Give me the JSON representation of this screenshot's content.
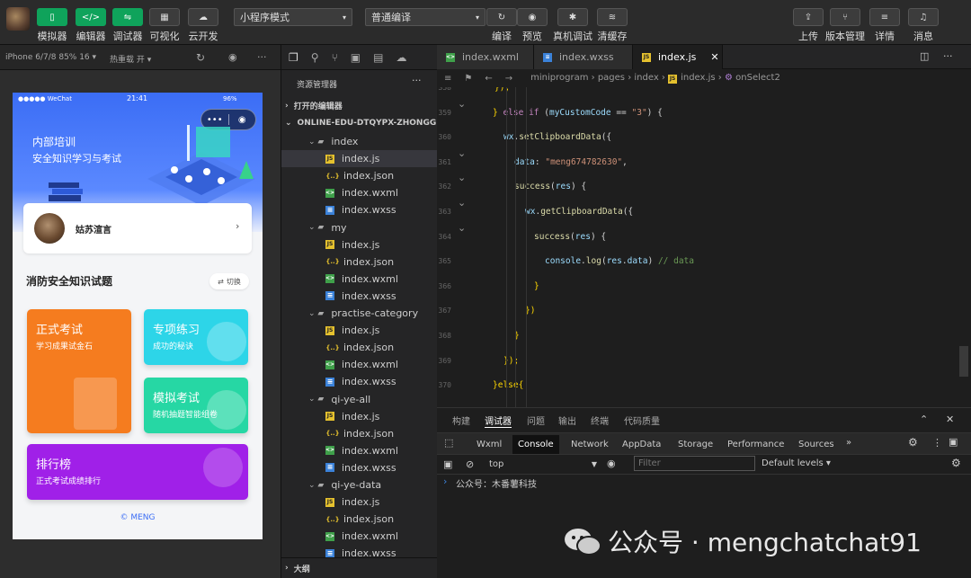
{
  "toolbar": {
    "left_buttons": [
      {
        "label": "模拟器",
        "icon": "phone-icon",
        "glyph": "▯"
      },
      {
        "label": "编辑器",
        "icon": "code-icon",
        "glyph": "</>"
      },
      {
        "label": "调试器",
        "icon": "debug-icon",
        "glyph": "⇋"
      },
      {
        "label": "可视化",
        "icon": "layout-icon",
        "glyph": "▦"
      },
      {
        "label": "云开发",
        "icon": "cloud-icon",
        "glyph": "☁"
      }
    ],
    "mode_select": "小程序模式",
    "compile_select": "普通编译",
    "mid_buttons": [
      {
        "label": "编译",
        "icon": "refresh-icon",
        "glyph": "↻"
      },
      {
        "label": "预览",
        "icon": "eye-icon",
        "glyph": "◉"
      },
      {
        "label": "真机调试",
        "icon": "bug-icon",
        "glyph": "✱"
      },
      {
        "label": "清缓存",
        "icon": "layers-icon",
        "glyph": "≋"
      }
    ],
    "right_buttons": [
      {
        "label": "上传",
        "icon": "upload-icon",
        "glyph": "⇪"
      },
      {
        "label": "版本管理",
        "icon": "branch-icon",
        "glyph": "⑂"
      },
      {
        "label": "详情",
        "icon": "menu-icon",
        "glyph": "≡"
      },
      {
        "label": "消息",
        "icon": "bell-icon",
        "glyph": "♫"
      }
    ]
  },
  "simulator": {
    "device": "iPhone 6/7/8 85% 16 ▾",
    "hot_reload": "热重载 开 ▾",
    "more": "···"
  },
  "phone": {
    "status_carrier": "●●●●● WeChat",
    "status_time": "21:41",
    "status_battery": "96%",
    "capsule_more": "•••",
    "banner_title": "内部培训",
    "banner_subtitle": "安全知识学习与考试",
    "user_name": "姑苏渲言",
    "section_title": "消防安全知识试题",
    "switch_label": "切换",
    "cards": [
      {
        "title": "正式考试",
        "desc": "学习成果试金石",
        "color": "#f57c1f"
      },
      {
        "title": "专项练习",
        "desc": "成功的秘诀",
        "color": "#2dd5e8"
      },
      {
        "title": "模拟考试",
        "desc": "随机抽题智能组卷",
        "color": "#26d7a4"
      },
      {
        "title": "排行榜",
        "desc": "正式考试成绩排行",
        "color": "#a020e8"
      }
    ],
    "footer": "© MENG"
  },
  "explorer": {
    "title": "资源管理器",
    "more": "···",
    "open_editors": "打开的编辑器",
    "project": "ONLINE-EDU-DTQYPX-ZHONGG...",
    "rows": [
      {
        "type": "folder",
        "label": "index",
        "indent": 1
      },
      {
        "type": "js",
        "label": "index.js",
        "indent": 2,
        "selected": true
      },
      {
        "type": "json",
        "label": "index.json",
        "indent": 2
      },
      {
        "type": "wxml",
        "label": "index.wxml",
        "indent": 2
      },
      {
        "type": "wxss",
        "label": "index.wxss",
        "indent": 2
      },
      {
        "type": "folder",
        "label": "my",
        "indent": 1
      },
      {
        "type": "js",
        "label": "index.js",
        "indent": 2
      },
      {
        "type": "json",
        "label": "index.json",
        "indent": 2
      },
      {
        "type": "wxml",
        "label": "index.wxml",
        "indent": 2
      },
      {
        "type": "wxss",
        "label": "index.wxss",
        "indent": 2
      },
      {
        "type": "folder",
        "label": "practise-category",
        "indent": 1
      },
      {
        "type": "js",
        "label": "index.js",
        "indent": 2
      },
      {
        "type": "json",
        "label": "index.json",
        "indent": 2
      },
      {
        "type": "wxml",
        "label": "index.wxml",
        "indent": 2
      },
      {
        "type": "wxss",
        "label": "index.wxss",
        "indent": 2
      },
      {
        "type": "folder",
        "label": "qi-ye-all",
        "indent": 1
      },
      {
        "type": "js",
        "label": "index.js",
        "indent": 2
      },
      {
        "type": "json",
        "label": "index.json",
        "indent": 2
      },
      {
        "type": "wxml",
        "label": "index.wxml",
        "indent": 2
      },
      {
        "type": "wxss",
        "label": "index.wxss",
        "indent": 2
      },
      {
        "type": "folder",
        "label": "qi-ye-data",
        "indent": 1
      },
      {
        "type": "js",
        "label": "index.js",
        "indent": 2
      },
      {
        "type": "json",
        "label": "index.json",
        "indent": 2
      },
      {
        "type": "wxml",
        "label": "index.wxml",
        "indent": 2
      },
      {
        "type": "wxss",
        "label": "index.wxss",
        "indent": 2
      }
    ],
    "outline": "大纲"
  },
  "editor": {
    "tabs": [
      {
        "label": "index.wxml",
        "type": "wxml"
      },
      {
        "label": "index.wxss",
        "type": "wxss"
      },
      {
        "label": "index.js",
        "type": "js",
        "active": true
      }
    ],
    "breadcrumb": [
      "miniprogram",
      "pages",
      "index",
      "index.js",
      "onSelect2"
    ],
    "lines": [
      {
        "n": "358",
        "html": "<span style='margin-left:64px' class='pl'>});</span>"
      },
      {
        "n": "359",
        "html": "<span style='margin-left:62px' class='pl'>}</span> <span class='kw'>else if</span> (<span class='var'>myCustomCode</span> == <span class='str'>\"3\"</span>) {"
      },
      {
        "n": "360",
        "html": "<span style='margin-left:74px'><span class='var'>wx</span>.<span class='fn'>setClipboardData</span>({</span>"
      },
      {
        "n": "361",
        "html": "<span style='margin-left:86px'><span class='var'>data</span>: <span class='str'>\"meng674782630\"</span>,</span>"
      },
      {
        "n": "362",
        "html": "<span style='margin-left:86px'><span class='fn'>success</span>(<span class='var'>res</span>) {</span>"
      },
      {
        "n": "363",
        "html": "<span style='margin-left:98px'><span class='var'>wx</span>.<span class='fn'>getClipboardData</span>({</span>"
      },
      {
        "n": "364",
        "html": "<span style='margin-left:108px'><span class='fn'>success</span>(<span class='var'>res</span>) {</span>"
      },
      {
        "n": "365",
        "html": "<span style='margin-left:120px'><span class='var'>console</span>.<span class='fn'>log</span>(<span class='var'>res</span>.<span class='var'>data</span>) <span class='cmt'>// data</span></span>"
      },
      {
        "n": "366",
        "html": "<span style='margin-left:108px' class='pl'>}</span>"
      },
      {
        "n": "367",
        "html": "<span style='margin-left:98px' class='pl'>})</span>"
      },
      {
        "n": "368",
        "html": "<span style='margin-left:86px' class='pl'>}</span>"
      },
      {
        "n": "369",
        "html": "<span style='margin-left:74px' class='pl'>});</span>"
      },
      {
        "n": "370",
        "html": "<span style='margin-left:62px' class='pl'>}else{</span>"
      }
    ]
  },
  "panel": {
    "tabs": [
      "构建",
      "调试器",
      "问题",
      "输出",
      "终端",
      "代码质量"
    ],
    "devtools_tabs": [
      "Wxml",
      "Console",
      "Network",
      "AppData",
      "Storage",
      "Performance",
      "Sources"
    ],
    "context": "top",
    "filter_placeholder": "Filter",
    "levels": "Default levels ▾",
    "console_output": "公众号：木番薯科技"
  },
  "watermark": "公众号 · mengchatchat91"
}
